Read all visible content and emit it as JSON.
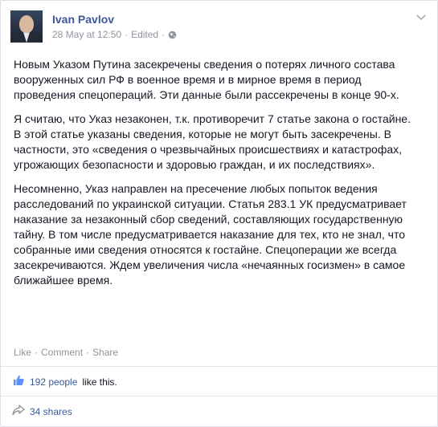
{
  "post": {
    "author": "Ivan Pavlov",
    "date": "28 May at 12:50",
    "separator": "·",
    "edited": "Edited",
    "paragraphs": [
      "Новым Указом Путина засекречены сведения о потерях личного состава вооруженных сил РФ в военное время и в мирное время в период проведения спецопераций. Эти данные были рассекречены в конце 90-х.",
      "Я считаю, что Указ незаконен, т.к. противоречит 7 статье закона о гостайне. В этой статье указаны сведения, которые не могут быть засекречены. В частности, это «сведения о чрезвычайных происшествиях и катастрофах, угрожающих безопасности и здоровью граждан, и их последствиях».",
      "Несомненно, Указ направлен на пресечение любых попыток ведения расследований по украинской ситуации. Статья 283.1 УК предусматривает наказание за незаконный сбор сведений, составляющих государственную тайну. В том числе предусматривается наказание для тех, кто не знал, что собранные ими сведения относятся к гостайне. Спецоперации же всегда засекречиваются. Ждем увеличения числа «нечаянных госизмен» в самое ближайшее время."
    ]
  },
  "actions": {
    "like": "Like",
    "comment": "Comment",
    "share": "Share",
    "dot": "·"
  },
  "stats": {
    "likes_count": "192 people",
    "likes_suffix": "like this.",
    "shares": "34 shares"
  },
  "icons": {
    "avatar": "avatar",
    "privacy": "globe-icon",
    "menu": "chevron-down-icon",
    "like": "thumbs-up-icon",
    "share": "share-arrow-icon"
  },
  "colors": {
    "link": "#3b5998",
    "meta": "#90949c",
    "text": "#141823"
  }
}
